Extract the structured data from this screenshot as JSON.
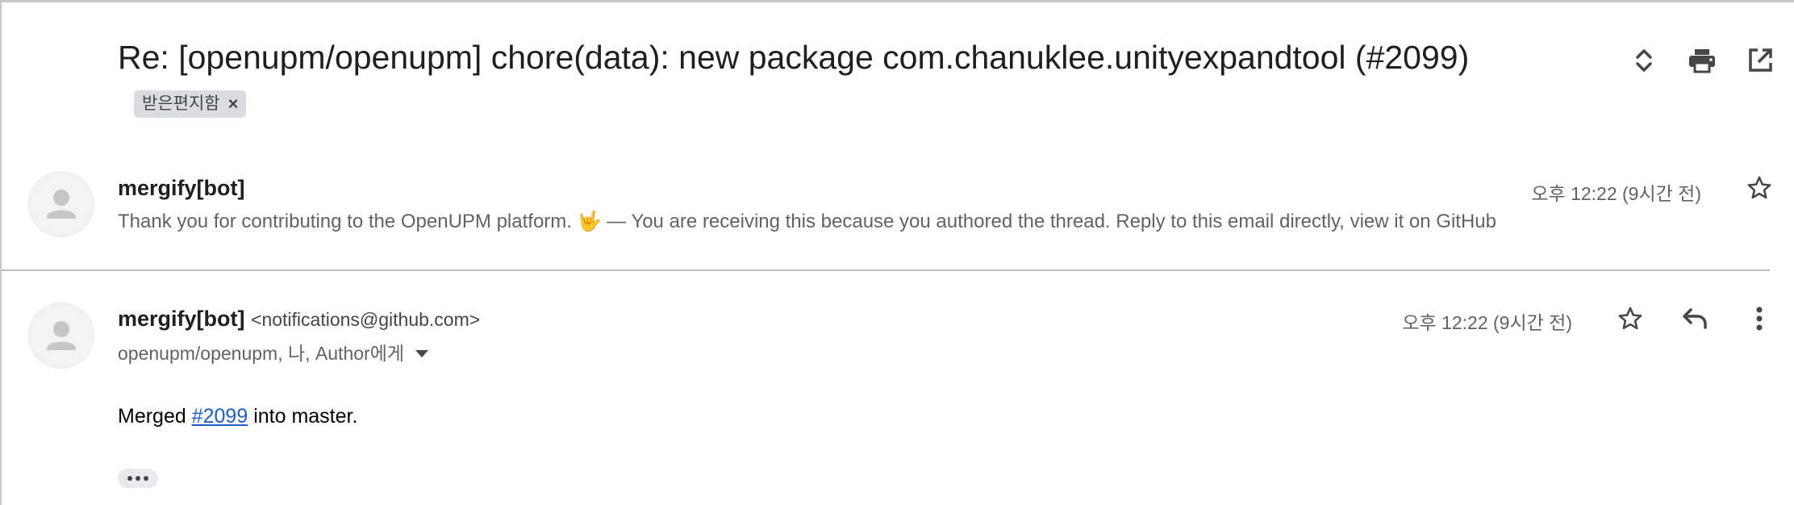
{
  "thread": {
    "subject": "Re: [openupm/openupm] chore(data): new package com.chanuklee.unityexpandtool (#2099)",
    "label_chip": "받은편지함",
    "label_remove": "×",
    "actions": [
      "expand-collapse-icon",
      "print-icon",
      "open-in-new-window-icon"
    ]
  },
  "collapsed_message": {
    "sender": "mergify[bot]",
    "snippet": "Thank you for contributing to the OpenUPM platform. 🤟 — You are receiving this because you authored the thread. Reply to this email directly, view it on GitHub",
    "time": "오후 12:22 (9시간 전)"
  },
  "expanded_message": {
    "sender": "mergify[bot]",
    "sender_email": "<notifications@github.com>",
    "recipients": "openupm/openupm, 나, Author에게",
    "time": "오후 12:22 (9시간 전)",
    "body_prefix": "Merged ",
    "body_link": "#2099",
    "body_suffix": " into master."
  },
  "colors": {
    "link": "#1a5fcc",
    "chip_bg": "#dadce0",
    "text_secondary": "#5f6368"
  }
}
